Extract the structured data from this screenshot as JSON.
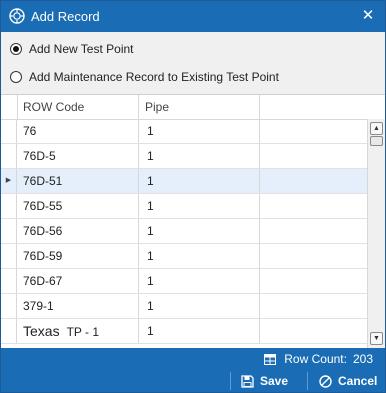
{
  "window": {
    "title": "Add Record",
    "close_glyph": "✕"
  },
  "options": {
    "new_test_point": "Add New Test Point",
    "maintenance_record": "Add Maintenance Record to Existing Test Point",
    "selected": "new_test_point"
  },
  "grid": {
    "columns": [
      "ROW Code",
      "Pipe",
      ""
    ],
    "selected_row_index": 2,
    "rows": [
      {
        "code": "76",
        "pipe": "1"
      },
      {
        "code": "76D-5",
        "pipe": "1"
      },
      {
        "code": "76D-51",
        "pipe": "1"
      },
      {
        "code": "76D-55",
        "pipe": "1"
      },
      {
        "code": "76D-56",
        "pipe": "1"
      },
      {
        "code": "76D-59",
        "pipe": "1"
      },
      {
        "code": "76D-67",
        "pipe": "1"
      },
      {
        "code": "379-1",
        "pipe": "1"
      },
      {
        "code": "Texas",
        "code_suffix": "TP - 1",
        "pipe": "1"
      }
    ]
  },
  "status": {
    "row_count_label": "Row Count:",
    "row_count_value": "203"
  },
  "footer": {
    "save_label": "Save",
    "cancel_label": "Cancel"
  },
  "colors": {
    "accent": "#1a6db5",
    "selected_row": "#e4effb"
  }
}
